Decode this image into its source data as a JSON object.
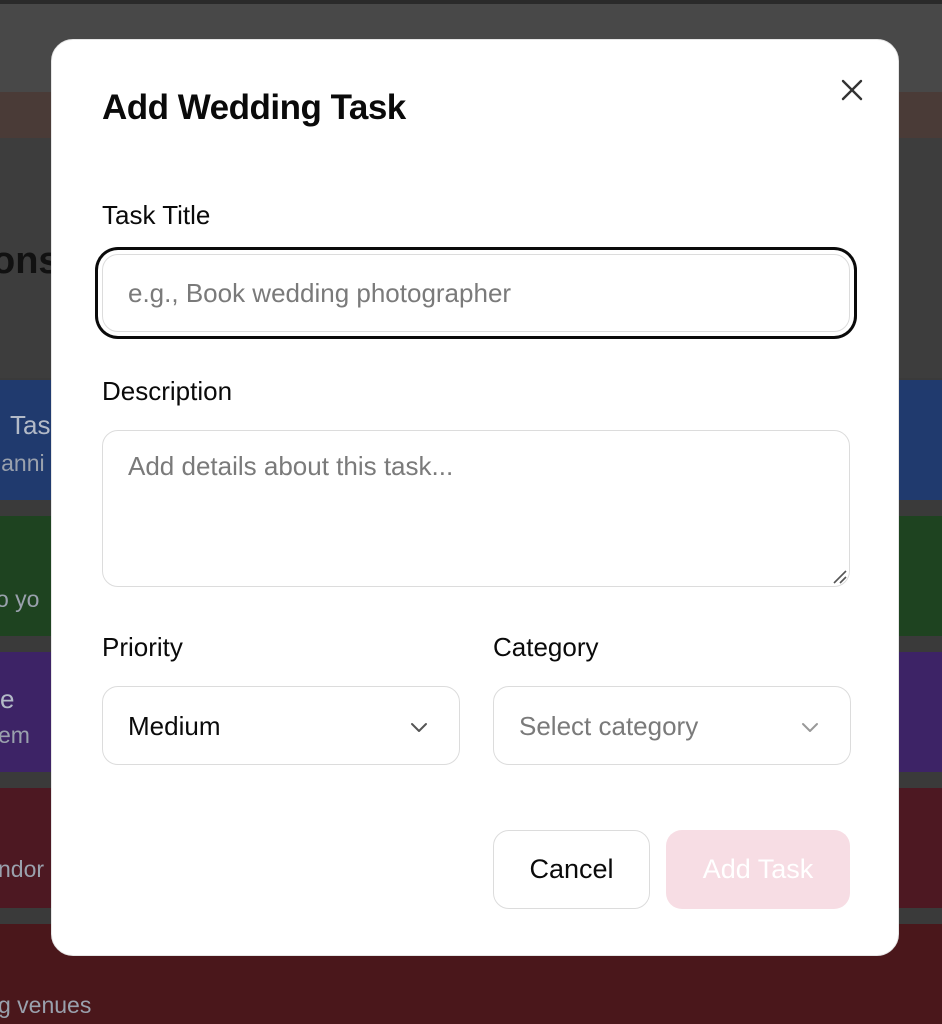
{
  "background": {
    "heading_fragment": "ons",
    "cards": [
      {
        "line1": "Tas",
        "line2": "lanni"
      },
      {
        "line1": "",
        "line2": "o yo"
      },
      {
        "line1": "e",
        "line2": "em"
      },
      {
        "line1": "",
        "line2": "ndor"
      },
      {
        "line1": "",
        "line2": "g venues"
      }
    ]
  },
  "modal": {
    "title": "Add Wedding Task",
    "close_icon": "close-icon",
    "fields": {
      "task_title": {
        "label": "Task Title",
        "value": "",
        "placeholder": "e.g., Book wedding photographer"
      },
      "description": {
        "label": "Description",
        "value": "",
        "placeholder": "Add details about this task..."
      },
      "priority": {
        "label": "Priority",
        "selected": "Medium"
      },
      "category": {
        "label": "Category",
        "placeholder": "Select category"
      }
    },
    "buttons": {
      "cancel": "Cancel",
      "add": "Add Task"
    }
  },
  "colors": {
    "overlay": "#3a3a3a",
    "modal_bg": "#ffffff",
    "add_button_disabled_bg": "#f7dde4",
    "focus_ring": "#0a0a0a"
  }
}
